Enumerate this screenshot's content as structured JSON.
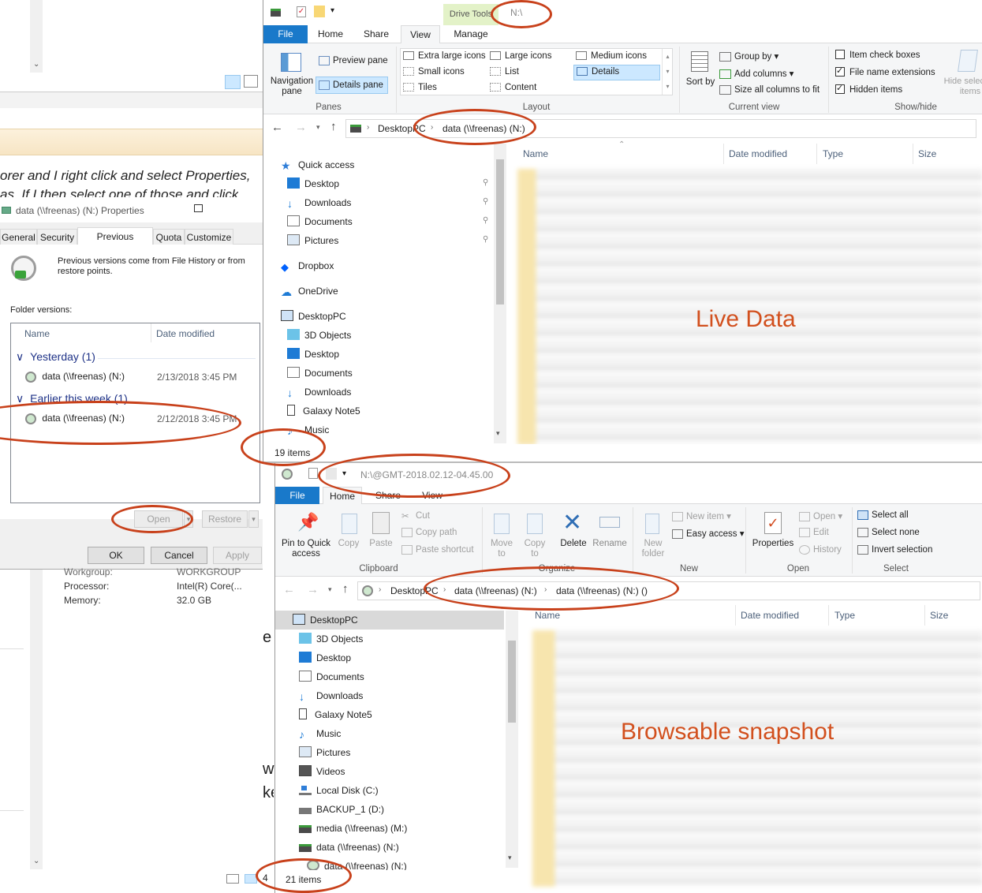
{
  "bg_text": {
    "line1": "orer and I right click and select Properties,",
    "line2": "as. If I then select one of those and click",
    "workgroup_label": "Workgroup:",
    "workgroup_value": "WORKGROUP",
    "processor_label": "Processor:",
    "processor_value": "Intel(R) Core(...",
    "memory_label": "Memory:",
    "memory_value": "32.0 GB",
    "frag_e": "e",
    "frag_w": "w",
    "frag_ke": "ke",
    "frag_4": "4"
  },
  "props": {
    "title": "data (\\\\freenas) (N:) Properties",
    "tabs": [
      "General",
      "Security",
      "Previous Versions",
      "Quota",
      "Customize"
    ],
    "info": "Previous versions come from File History or from restore points.",
    "folder_versions_label": "Folder versions:",
    "col_name": "Name",
    "col_date": "Date modified",
    "group1": "Yesterday (1)",
    "row1_name": "data (\\\\freenas) (N:)",
    "row1_date": "2/13/2018 3:45 PM",
    "group2": "Earlier this week (1)",
    "row2_name": "data (\\\\freenas) (N:)",
    "row2_date": "2/12/2018 3:45 PM",
    "open": "Open",
    "restore": "Restore",
    "ok": "OK",
    "cancel": "Cancel",
    "apply": "Apply"
  },
  "top": {
    "context_tab": "Drive Tools",
    "title": "N:\\",
    "tabs": [
      "File",
      "Home",
      "Share",
      "View",
      "Manage"
    ],
    "panes": {
      "nav_pane": "Navigation pane",
      "preview": "Preview pane",
      "details": "Details pane",
      "group": "Panes"
    },
    "layout": {
      "items": [
        "Extra large icons",
        "Large icons",
        "Medium icons",
        "Small icons",
        "List",
        "Details",
        "Tiles",
        "Content"
      ],
      "group": "Layout"
    },
    "current_view": {
      "sort": "Sort by",
      "group_by": "Group by",
      "add_columns": "Add columns",
      "size_all": "Size all columns to fit",
      "group": "Current view"
    },
    "show_hide": {
      "item_check": "Item check boxes",
      "file_ext": "File name extensions",
      "hidden": "Hidden items",
      "hide_selected": "Hide selected items",
      "group": "Show/hide"
    },
    "breadcrumb": [
      "DesktopPC",
      "data (\\\\freenas) (N:)"
    ],
    "columns": [
      "Name",
      "Date modified",
      "Type",
      "Size"
    ],
    "nav": [
      "Quick access",
      "Desktop",
      "Downloads",
      "Documents",
      "Pictures",
      "Dropbox",
      "OneDrive",
      "DesktopPC",
      "3D Objects",
      "Desktop",
      "Documents",
      "Downloads",
      "Galaxy Note5",
      "Music"
    ],
    "status": "19 items",
    "overlay": "Live Data"
  },
  "bottom": {
    "title": "N:\\@GMT-2018.02.12-04.45.00",
    "tabs": [
      "File",
      "Home",
      "Share",
      "View"
    ],
    "clipboard": {
      "pin": "Pin to Quick access",
      "copy": "Copy",
      "paste": "Paste",
      "cut": "Cut",
      "copy_path": "Copy path",
      "paste_shortcut": "Paste shortcut",
      "group": "Clipboard"
    },
    "organize": {
      "move_to": "Move to",
      "copy_to": "Copy to",
      "delete": "Delete",
      "rename": "Rename",
      "group": "Organize"
    },
    "new": {
      "new_folder": "New folder",
      "new_item": "New item",
      "easy_access": "Easy access",
      "group": "New"
    },
    "open": {
      "properties": "Properties",
      "open": "Open",
      "edit": "Edit",
      "history": "History",
      "group": "Open"
    },
    "select": {
      "select_all": "Select all",
      "select_none": "Select none",
      "invert": "Invert selection",
      "group": "Select"
    },
    "breadcrumb": [
      "DesktopPC",
      "data (\\\\freenas) (N:)",
      "data (\\\\freenas) (N:) ()"
    ],
    "columns": [
      "Name",
      "Date modified",
      "Type",
      "Size"
    ],
    "nav": [
      "DesktopPC",
      "3D Objects",
      "Desktop",
      "Documents",
      "Downloads",
      "Galaxy Note5",
      "Music",
      "Pictures",
      "Videos",
      "Local Disk (C:)",
      "BACKUP_1 (D:)",
      "media (\\\\freenas) (M:)",
      "data (\\\\freenas) (N:)",
      "data (\\\\freenas) (N:)"
    ],
    "status": "21 items",
    "overlay": "Browsable snapshot"
  },
  "colors": {
    "annotation": "#c8411b",
    "file_tab": "#1979ca",
    "context_tab": "#e3f2c8",
    "selection": "#cce8ff"
  }
}
